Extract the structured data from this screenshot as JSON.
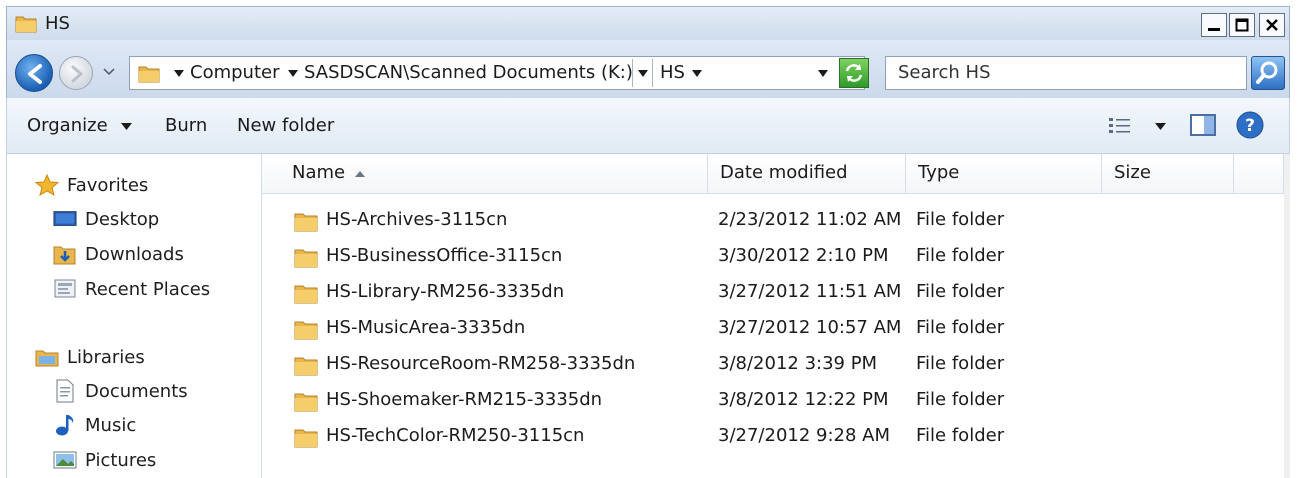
{
  "window": {
    "title": "HS"
  },
  "address": {
    "crumbs": [
      "Computer",
      "SASDSCAN\\Scanned Documents (K:)",
      "HS"
    ],
    "search_placeholder": "Search HS"
  },
  "toolbar": {
    "organize": "Organize",
    "burn": "Burn",
    "new_folder": "New folder"
  },
  "nav": {
    "favorites": {
      "label": "Favorites",
      "items": [
        "Desktop",
        "Downloads",
        "Recent Places"
      ]
    },
    "libraries": {
      "label": "Libraries",
      "items": [
        "Documents",
        "Music",
        "Pictures"
      ]
    }
  },
  "columns": {
    "name": "Name",
    "date": "Date modified",
    "type": "Type",
    "size": "Size"
  },
  "files": [
    {
      "name": "HS-Archives-3115cn",
      "date": "2/23/2012 11:02 AM",
      "type": "File folder"
    },
    {
      "name": "HS-BusinessOffice-3115cn",
      "date": "3/30/2012 2:10 PM",
      "type": "File folder"
    },
    {
      "name": "HS-Library-RM256-3335dn",
      "date": "3/27/2012 11:51 AM",
      "type": "File folder"
    },
    {
      "name": "HS-MusicArea-3335dn",
      "date": "3/27/2012 10:57 AM",
      "type": "File folder"
    },
    {
      "name": "HS-ResourceRoom-RM258-3335dn",
      "date": "3/8/2012 3:39 PM",
      "type": "File folder"
    },
    {
      "name": "HS-Shoemaker-RM215-3335dn",
      "date": "3/8/2012 12:22 PM",
      "type": "File folder"
    },
    {
      "name": "HS-TechColor-RM250-3115cn",
      "date": "3/27/2012 9:28 AM",
      "type": "File folder"
    }
  ],
  "icons": {
    "folder": "folder-icon",
    "star": "star-icon",
    "desktop": "desktop-icon",
    "downloads": "downloads-icon",
    "recent": "recent-places-icon",
    "libraries": "libraries-icon",
    "documents": "documents-icon",
    "music": "music-icon",
    "pictures": "pictures-icon",
    "search": "search-icon",
    "refresh": "refresh-icon",
    "views": "views-icon",
    "preview": "preview-pane-icon",
    "help": "help-icon"
  },
  "colors": {
    "folder": "#e8b64c",
    "accent": "#1a5fb4",
    "chrome": "#dfe9f6"
  }
}
